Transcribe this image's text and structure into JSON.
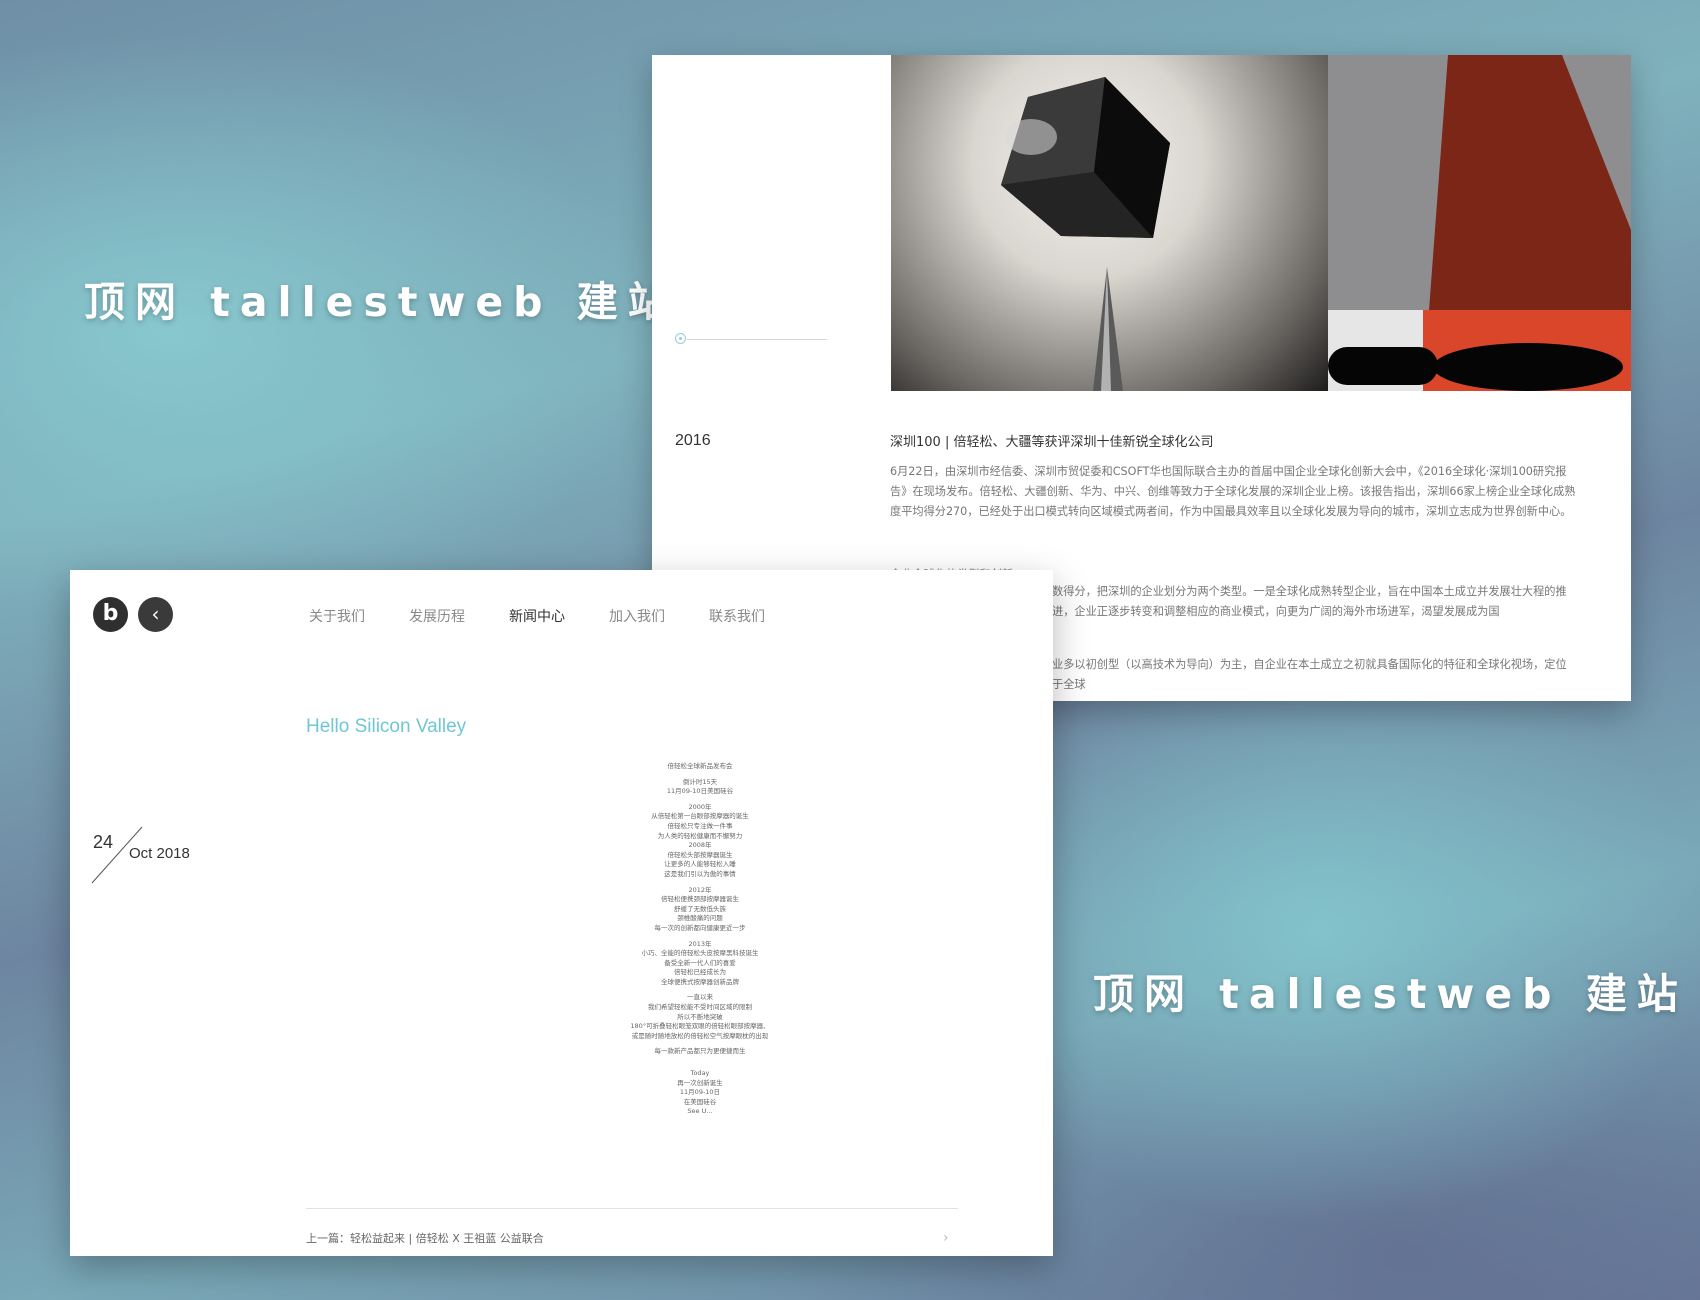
{
  "watermark": {
    "text_top": "顶网 tallestweb 建站",
    "text_bottom": "顶网 tallestweb 建站"
  },
  "back_page": {
    "timeline_year": "2016",
    "news_title": "深圳100 | 倍轻松、大疆等获评深圳十佳新锐全球化公司",
    "paragraph_1": "6月22日，由深圳市经信委、深圳市贸促委和CSOFT华也国际联合主办的首届中国企业全球化创新大会中，《2016全球化·深圳100研究报告》在现场发布。倍轻松、大疆创新、华为、中兴、创维等致力于全球化发展的深圳企业上榜。该报告指出，深圳66家上榜企业全球化成熟度平均得分270，已经处于出口模式转向区域模式两者间，作为中国最具效率且以全球化发展为导向的城市，深圳立志成为世界创新中心。",
    "paragraph_cut": "企业全球化的类型和创新",
    "paragraph_2": "数得分，把深圳的企业划分为两个类型。一是全球化成熟转型企业，旨在中国本土成立并发展壮大程的推进，企业正逐步转变和调整相应的商业模式，向更为广阔的海外市场进军，渴望发展成为国",
    "paragraph_3": "业多以初创型（以高技术为导向）为主，自企业在本土成立之初就具备国际化的特征和全球化视场，定位于全球"
  },
  "front_page": {
    "logo_letter": "b",
    "back_icon": "chevron-left-icon",
    "nav": [
      {
        "label": "关于我们"
      },
      {
        "label": "发展历程"
      },
      {
        "label": "新闻中心",
        "active": true
      },
      {
        "label": "加入我们"
      },
      {
        "label": "联系我们"
      }
    ],
    "article_title": "Hello Silicon Valley",
    "date_day": "24",
    "date_month_year": "Oct 2018",
    "poem_lines": [
      "倍轻松全球新品发布会",
      "",
      "倒计时15天",
      "11月09-10日美国硅谷",
      "",
      "2000年",
      "从倍轻松第一台眼部按摩器的诞生",
      "倍轻松只专注做一件事",
      "为人类的轻松健康而不懈努力",
      "2008年",
      "倍轻松头部按摩器诞生",
      "让更多的人能够轻松入睡",
      "这是我们引以为傲的事情",
      "",
      "2012年",
      "倍轻松便携颈部按摩器诞生",
      "舒缓了无数低头族",
      "颈椎酸痛的问题",
      "每一次的创新都向健康更近一步",
      "",
      "2013年",
      "小巧、全能的倍轻松头皮按摩黑科技诞生",
      "备受全新一代人们的喜爱",
      "倍轻松已经成长为",
      "全球便携式按摩器创新品牌",
      "",
      "一直以来",
      "我们希望轻松能不受时间区域的限制",
      "所以不断地突破",
      "180°可折叠轻松眼笼双眼的倍轻松眼部按摩器、",
      "或是随时随地放松的倍轻松空气按摩眼枕的出现",
      "",
      "每一款新产品都只为更便捷而生",
      "",
      "",
      "Today",
      "再一次创新诞生",
      "11月09-10日",
      "在美国硅谷",
      "See U..."
    ],
    "prev_link": "上一篇：轻松益起来 | 倍轻松 X 王祖蓝 公益联合",
    "next_icon": "chevron-right-icon"
  }
}
